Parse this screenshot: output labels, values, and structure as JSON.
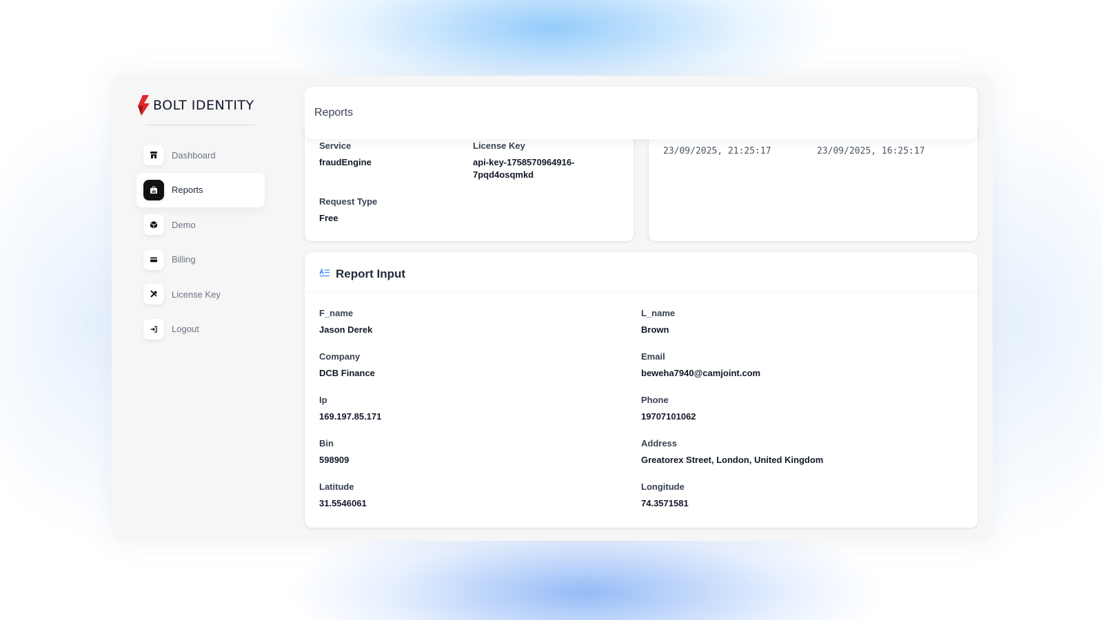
{
  "brand": {
    "name": "BOLT IDENTITY",
    "icon": "bolt-logo-icon"
  },
  "sidebar": {
    "items": [
      {
        "label": "Dashboard",
        "icon": "store-icon",
        "active": false
      },
      {
        "label": "Reports",
        "icon": "chart-bag-icon",
        "active": true
      },
      {
        "label": "Demo",
        "icon": "box-icon",
        "active": false
      },
      {
        "label": "Billing",
        "icon": "credit-card-icon",
        "active": false
      },
      {
        "label": "License Key",
        "icon": "tools-icon",
        "active": false
      },
      {
        "label": "Logout",
        "icon": "logout-icon",
        "active": false
      }
    ]
  },
  "header": {
    "title": "Reports"
  },
  "summary": {
    "service_label": "Service",
    "service_value": "fraudEngine",
    "license_label": "License Key",
    "license_value_line1": "api-key-1758570964916-",
    "license_value_line2": "7pqd4osqmkd",
    "request_type_label": "Request Type",
    "request_type_value": "Free"
  },
  "times": {
    "first": "23/09/2025, 21:25:17",
    "second": "23/09/2025, 16:25:17"
  },
  "report_input": {
    "title": "Report Input",
    "icon": "text-align-icon",
    "fields": [
      {
        "label": "F_name",
        "value": "Jason Derek"
      },
      {
        "label": "L_name",
        "value": "Brown"
      },
      {
        "label": "Company",
        "value": "DCB Finance"
      },
      {
        "label": "Email",
        "value": "beweha7940@camjoint.com"
      },
      {
        "label": "Ip",
        "value": "169.197.85.171"
      },
      {
        "label": "Phone",
        "value": "19707101062"
      },
      {
        "label": "Bin",
        "value": "598909"
      },
      {
        "label": "Address",
        "value": "Greatorex Street, London, United Kingdom"
      },
      {
        "label": "Latitude",
        "value": "31.5546061"
      },
      {
        "label": "Longitude",
        "value": "74.3571581"
      }
    ]
  },
  "colors": {
    "brand_red": "#e0262b",
    "accent_blue": "#3b82f6",
    "active_icon_bg": "#111111"
  }
}
